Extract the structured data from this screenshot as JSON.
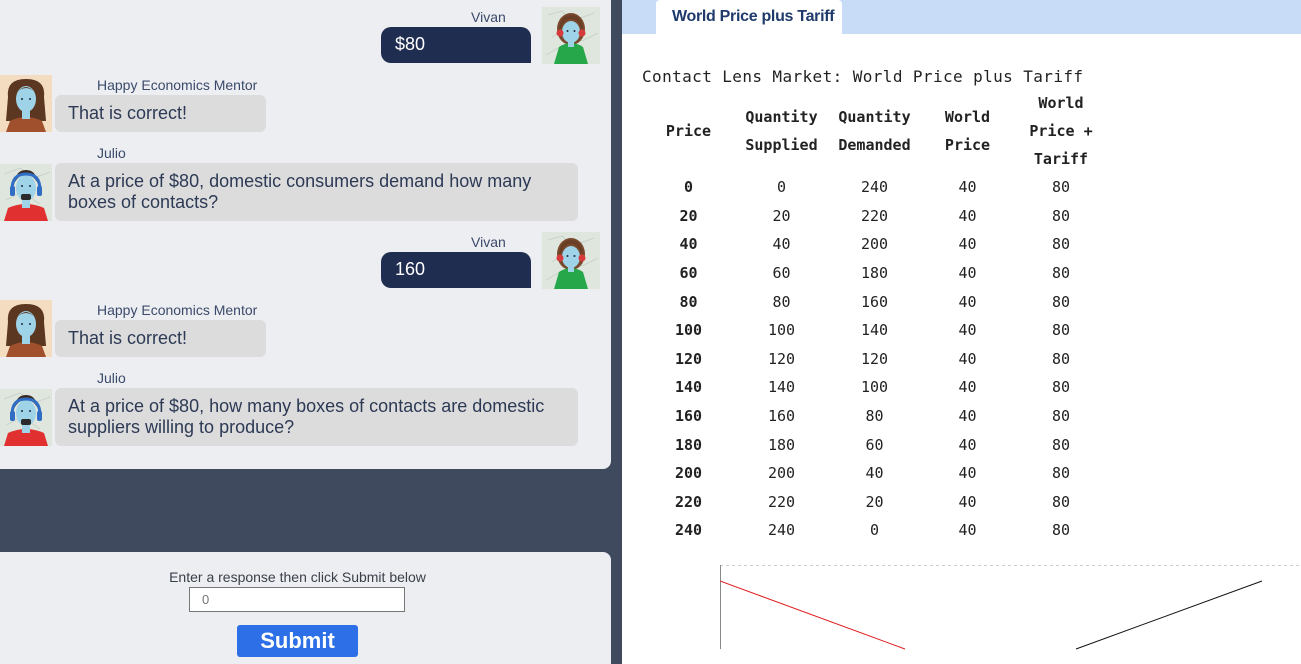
{
  "chat": {
    "messages": [
      {
        "sender": "Vivan",
        "text": "$80"
      },
      {
        "sender": "Happy Economics Mentor",
        "text": "That is correct!"
      },
      {
        "sender": "Julio",
        "text": "At a price of $80, domestic consumers demand how many boxes of contacts?"
      },
      {
        "sender": "Vivan",
        "text": "160"
      },
      {
        "sender": "Happy Economics Mentor",
        "text": "That is correct!"
      },
      {
        "sender": "Julio",
        "text": "At a price of $80, how many boxes of contacts are domestic suppliers willing to produce?"
      }
    ]
  },
  "input": {
    "prompt": "Enter a response then click Submit below",
    "placeholder": "0",
    "submit_label": "Submit"
  },
  "panel": {
    "tab_label": "World Price plus Tariff",
    "table_title": "Contact Lens Market: World Price plus Tariff",
    "headers": [
      "Price",
      "Quantity Supplied",
      "Quantity Demanded",
      "World Price",
      "World Price + Tariff"
    ],
    "rows": [
      [
        "0",
        "0",
        "240",
        "40",
        "80"
      ],
      [
        "20",
        "20",
        "220",
        "40",
        "80"
      ],
      [
        "40",
        "40",
        "200",
        "40",
        "80"
      ],
      [
        "60",
        "60",
        "180",
        "40",
        "80"
      ],
      [
        "80",
        "80",
        "160",
        "40",
        "80"
      ],
      [
        "100",
        "100",
        "140",
        "40",
        "80"
      ],
      [
        "120",
        "120",
        "120",
        "40",
        "80"
      ],
      [
        "140",
        "140",
        "100",
        "40",
        "80"
      ],
      [
        "160",
        "160",
        "80",
        "40",
        "80"
      ],
      [
        "180",
        "180",
        "60",
        "40",
        "80"
      ],
      [
        "200",
        "200",
        "40",
        "40",
        "80"
      ],
      [
        "220",
        "220",
        "20",
        "40",
        "80"
      ],
      [
        "240",
        "240",
        "0",
        "40",
        "80"
      ]
    ]
  },
  "colors": {
    "user_bubble": "#1f2d50",
    "bot_bubble": "#dcdcdc",
    "submit": "#2d6fe6",
    "tab_strip": "#c9dcf7",
    "demand_line": "#e02020",
    "supply_line": "#111111"
  }
}
